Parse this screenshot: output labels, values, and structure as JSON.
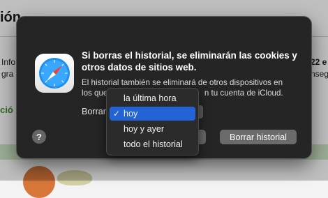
{
  "background": {
    "heading_fragment": "ión",
    "line_fragments": {
      "left_row1": "Info",
      "left_row2": "gra",
      "right_row1": "22 e",
      "right_row2": "nseg"
    },
    "green_fragment": "ció"
  },
  "dialog": {
    "icon": "safari-compass-icon",
    "title": "Si borras el historial, se eliminarán las cookies y otros datos de sitios web.",
    "body_line1": "El historial también se eliminará de otros dispositivos en",
    "body_line2_start": "los que",
    "body_line2_end": "n tu cuenta de iCloud.",
    "clear_label": "Borrar",
    "help_label": "?",
    "clear_button": "Borrar historial"
  },
  "menu": {
    "items": [
      {
        "label": "la última hora",
        "selected": false
      },
      {
        "label": "hoy",
        "selected": true
      },
      {
        "label": "hoy y ayer",
        "selected": false
      },
      {
        "label": "todo el historial",
        "selected": false
      }
    ],
    "check_glyph": "✓"
  },
  "colors": {
    "dialog_bg": "#252525",
    "menu_bg": "#2b2b2b",
    "selection": "#2463d6",
    "page_green_text": "#3f8a2f",
    "page_green_bar": "#cfe7c6"
  }
}
